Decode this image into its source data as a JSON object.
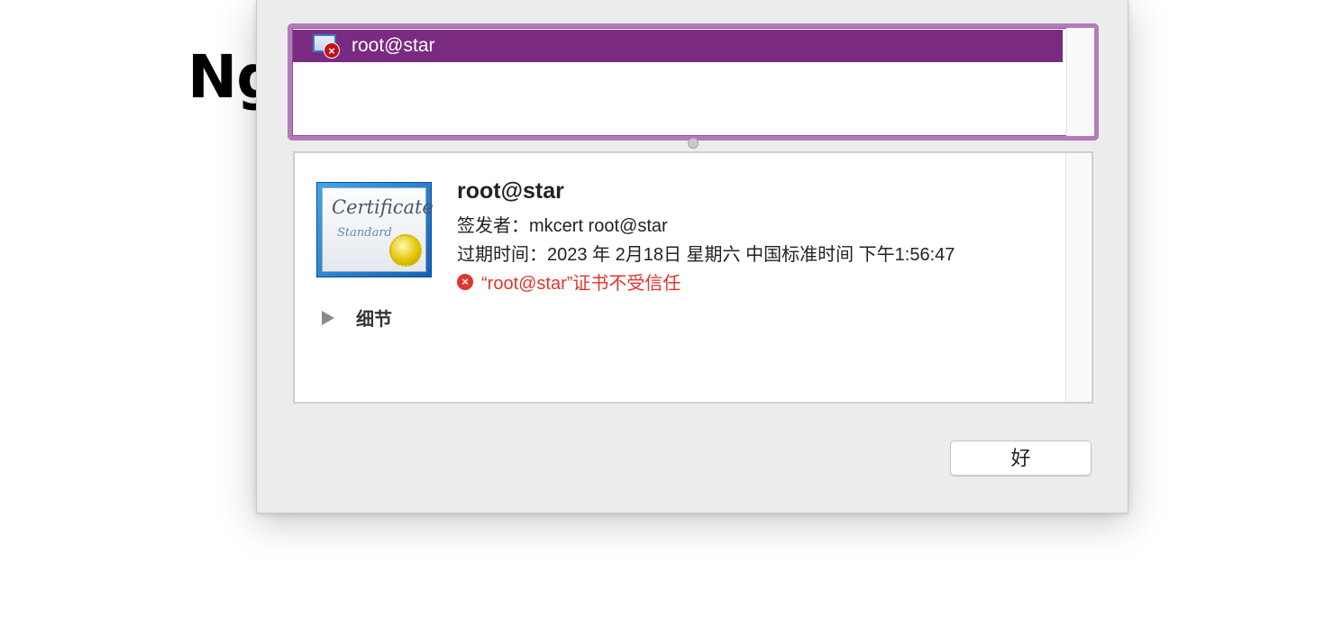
{
  "background": {
    "heading": "Ng"
  },
  "cert_list": {
    "items": [
      {
        "label": "root@star",
        "icon": "certificate-untrusted-icon",
        "selected": true
      }
    ],
    "selection_color": "#7b2a82",
    "focus_ring_color": "#b27cb8"
  },
  "details": {
    "name": "root@star",
    "issuer_line": "签发者：mkcert root@star",
    "expires_line": "过期时间：2023 年 2月18日 星期六 中国标准时间 下午1:56:47",
    "trust_status": "“root@star”证书不受信任",
    "trust_status_color": "#e0352b",
    "icon_text_1": "Certificate",
    "icon_text_2": "Standard",
    "disclosure_label": "细节"
  },
  "buttons": {
    "ok_label": "好"
  }
}
